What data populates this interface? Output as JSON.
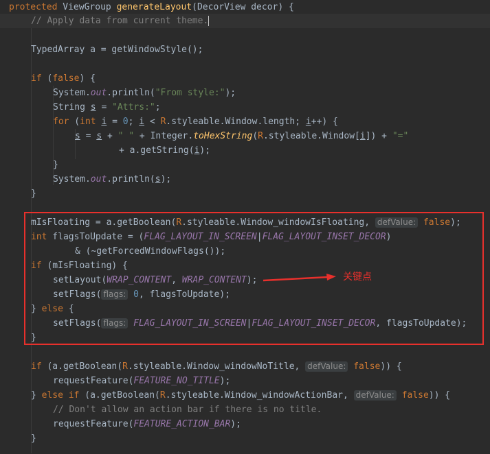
{
  "code": {
    "l1_kw": "protected",
    "l1_type": "ViewGroup",
    "l1_fn": "generateLayout",
    "l1_rest": "(DecorView decor) {",
    "l2_cmt": "// Apply data from current theme.",
    "l3": "TypedArray a = getWindowStyle();",
    "l4_kw": "if",
    "l4_false": "false",
    "l5_a": "System.",
    "l5_out": "out",
    "l5_b": ".println(",
    "l5_str": "\"From style:\"",
    "l5_c": ");",
    "l6_a": "String ",
    "l6_s": "s",
    "l6_b": " = ",
    "l6_str": "\"Attrs:\"",
    "l6_c": ";",
    "l7_for": "for",
    "l7_int": "int",
    "l7_i": "i",
    "l7_zero": "0",
    "l7_R": "R",
    "l7_rest": ".styleable.Window.length; ",
    "l8_s": "s",
    "l8_s2": "s",
    "l8_str1": "\" \"",
    "l8_mid": "Integer.",
    "l8_hex": "toHexString",
    "l8_R": "R",
    "l8_win": ".styleable.Window[",
    "l8_i": "i",
    "l8_end": "]) + ",
    "l8_str2": "\"=\"",
    "l9_a": "+ a.getString(",
    "l9_i": "i",
    "l9_b": ");",
    "l10": "}",
    "l11_a": "System.",
    "l11_out": "out",
    "l11_b": ".println(",
    "l11_s": "s",
    "l11_c": ");",
    "l12": "}",
    "l13_a": "mIsFloating = a.getBoolean(",
    "l13_R": "R",
    "l13_b": ".styleable.Window_windowIsFloating, ",
    "l13_hint": "defValue:",
    "l13_false": "false",
    "l13_c": ");",
    "l14_int": "int",
    "l14_a": " flagsToUpdate = (",
    "l14_f1": "FLAG_LAYOUT_IN_SCREEN",
    "l14_pipe": "|",
    "l14_f2": "FLAG_LAYOUT_INSET_DECOR",
    "l14_b": ")",
    "l15": "& (~getForcedWindowFlags());",
    "l16_if": "if",
    "l16_rest": " (mIsFloating) {",
    "l17_a": "setLayout(",
    "l17_w1": "WRAP_CONTENT",
    "l17_comma": ", ",
    "l17_w2": "WRAP_CONTENT",
    "l17_b": ");",
    "l18_a": "setFlags(",
    "l18_hint": "flags:",
    "l18_zero": "0",
    "l18_b": ", flagsToUpdate);",
    "l19_a": "} ",
    "l19_else": "else",
    "l19_b": " {",
    "l20_a": "setFlags(",
    "l20_hint": "flags:",
    "l20_f1": "FLAG_LAYOUT_IN_SCREEN",
    "l20_pipe": "|",
    "l20_f2": "FLAG_LAYOUT_INSET_DECOR",
    "l20_b": ", flagsToUpdate);",
    "l21": "}",
    "l22_if": "if",
    "l22_a": " (a.getBoolean(",
    "l22_R": "R",
    "l22_b": ".styleable.Window_windowNoTitle, ",
    "l22_hint": "defValue:",
    "l22_false": "false",
    "l22_c": ")) {",
    "l23_a": "requestFeature(",
    "l23_f": "FEATURE_NO_TITLE",
    "l23_b": ");",
    "l24_a": "} ",
    "l24_else": "else if",
    "l24_b": " (a.getBoolean(",
    "l24_R": "R",
    "l24_c": ".styleable.Window_windowActionBar, ",
    "l24_hint": "defValue:",
    "l24_false": "false",
    "l24_d": ")) {",
    "l25_cmt": "// Don't allow an action bar if there is no title.",
    "l26_a": "requestFeature(",
    "l26_f": "FEATURE_ACTION_BAR",
    "l26_b": ");",
    "l27": "}"
  },
  "annotation": {
    "label": "关键点"
  },
  "colors": {
    "background": "#2b2b2b",
    "keyword": "#cc7832",
    "string": "#6a8759",
    "number": "#6897bb",
    "method": "#ffc66d",
    "constant": "#9876aa",
    "comment": "#808080",
    "highlight": "#e8302c"
  }
}
